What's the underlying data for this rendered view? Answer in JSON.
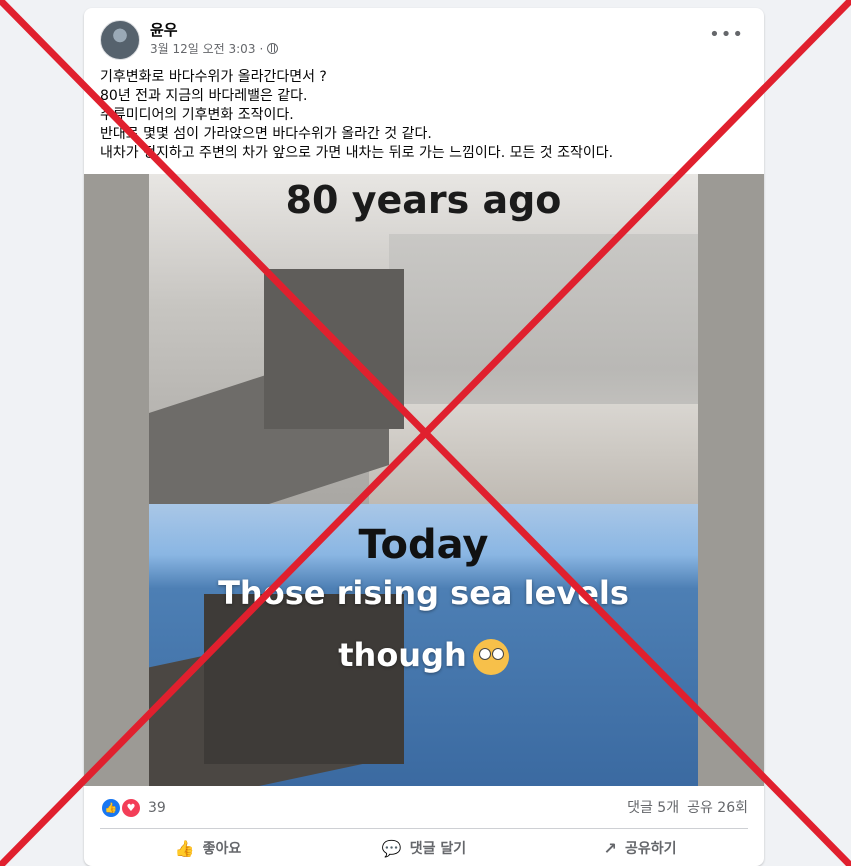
{
  "post": {
    "author": "윤우",
    "timestamp": "3월 12일 오전 3:03",
    "privacy_icon": "globe-icon",
    "more_icon": "more-options-icon",
    "text_lines": [
      "기후변화로 바다수위가 올라간다면서 ?",
      "80년 전과 지금의 바다레밸은 같다.",
      "주류미디어의 기후변화 조작이다.",
      "반대로 몇몇 섬이 가라앉으면 바다수위가 올라간 것 같다.",
      "내차가 정지하고 주변의 차가 앞으로 가면 내차는 뒤로 가는 느낌이다. 모든 것 조작이다."
    ]
  },
  "image": {
    "caption_top": "80 years ago",
    "caption_today": "Today",
    "caption_rising": "Those rising sea levels",
    "caption_though": "though"
  },
  "stats": {
    "reaction_count": "39",
    "comments": "댓글 5개",
    "shares": "공유 26회"
  },
  "actions": {
    "like": "좋아요",
    "comment": "댓글 달기",
    "share": "공유하기"
  },
  "colors": {
    "accent": "#1877f2",
    "love": "#f33e58",
    "overlay_x": "#e0202e"
  }
}
